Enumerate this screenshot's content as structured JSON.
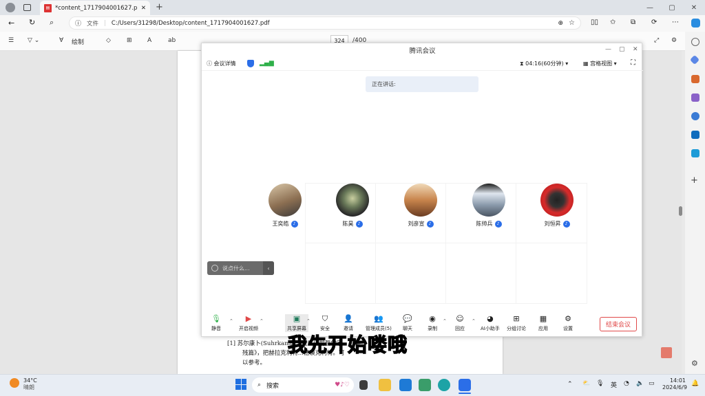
{
  "browser": {
    "tab_title": "*content_1717904001627.pdf",
    "address_prefix": "文件",
    "url": "C:/Users/31298/Desktop/content_1717904001627.pdf"
  },
  "pdf_toolbar": {
    "draw_label": "绘制",
    "page_current": "324",
    "page_total": "/400"
  },
  "meeting": {
    "title": "腾讯会议",
    "info_label": "会议详情",
    "timer": "04:16(60分钟)",
    "view_label": "宫格视图",
    "speaking_label": "正在讲话:",
    "input_placeholder": "说点什么...",
    "participants": [
      {
        "name": "王奕皓",
        "color": "#b9a08a"
      },
      {
        "name": "陈昊",
        "color": "#3d4a3e"
      },
      {
        "name": "刘彦宣",
        "color": "#c8844c"
      },
      {
        "name": "陈帅兵",
        "color": "#6b7b8f"
      },
      {
        "name": "刘恒昇",
        "color": "#d62b2b"
      }
    ],
    "toolbar": {
      "mute": "静音",
      "video": "开启视频",
      "share": "共享屏幕",
      "security": "安全",
      "invite": "邀请",
      "members": "管理成员(5)",
      "chat": "聊天",
      "record": "录制",
      "reaction": "回应",
      "ai": "AI小助手",
      "breakout": "分组讨论",
      "apps": "应用",
      "settings": "设置",
      "end": "结束会议"
    }
  },
  "pdf_content": {
    "footnote_line1": "[1]  苏尔康卜(Suhrkamp)...拉底以前哲学家",
    "footnote_line2": "残篇》，把赫拉克利特...德谟克利特。可",
    "footnote_line3": "以参考。"
  },
  "subtitle": "我先开始喽哦",
  "taskbar": {
    "weather_temp": "34°C",
    "weather_desc": "晴朗",
    "search_label": "搜索",
    "ime": "英",
    "time": "14:01",
    "date": "2024/6/9"
  }
}
